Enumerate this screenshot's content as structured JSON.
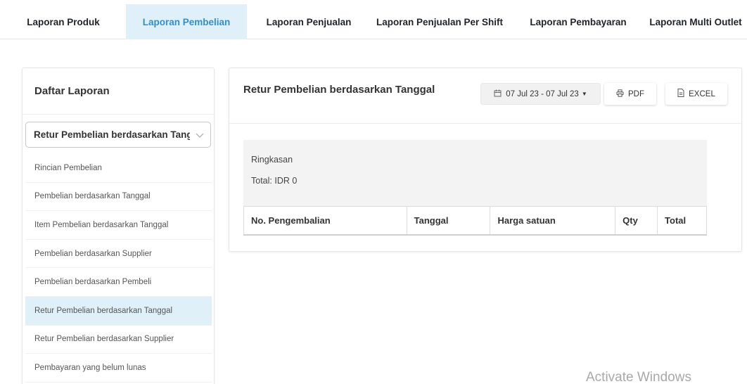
{
  "tabs": [
    {
      "label": "Laporan Produk",
      "active": false
    },
    {
      "label": "Laporan Pembelian",
      "active": true
    },
    {
      "label": "Laporan Penjualan",
      "active": false
    },
    {
      "label": "Laporan Penjualan Per Shift",
      "active": false
    },
    {
      "label": "Laporan Pembayaran",
      "active": false
    },
    {
      "label": "Laporan Multi Outlet",
      "active": false
    }
  ],
  "sidebar": {
    "title": "Daftar Laporan",
    "selected": "Retur Pembelian berdasarkan Tanggal",
    "items": [
      {
        "label": "Rincian Pembelian"
      },
      {
        "label": "Pembelian berdasarkan Tanggal"
      },
      {
        "label": "Item Pembelian berdasarkan Tanggal"
      },
      {
        "label": "Pembelian berdasarkan Supplier"
      },
      {
        "label": "Pembelian berdasarkan Pembeli"
      },
      {
        "label": "Retur Pembelian berdasarkan Tanggal",
        "active": true
      },
      {
        "label": "Retur Pembelian berdasarkan Supplier"
      },
      {
        "label": "Pembayaran yang belum lunas"
      }
    ]
  },
  "report": {
    "title": "Retur Pembelian berdasarkan Tanggal",
    "date_range": "07 Jul 23 - 07 Jul 23",
    "pdf_label": "PDF",
    "excel_label": "EXCEL",
    "summary_title": "Ringkasan",
    "summary_total": "Total: IDR 0",
    "columns": [
      "No. Pengembalian",
      "Tanggal",
      "Harga satuan",
      "Qty",
      "Total"
    ]
  },
  "watermark": "Activate Windows",
  "colors": {
    "accent": "#2f8fd0",
    "active_bg": "#dff0f9"
  }
}
